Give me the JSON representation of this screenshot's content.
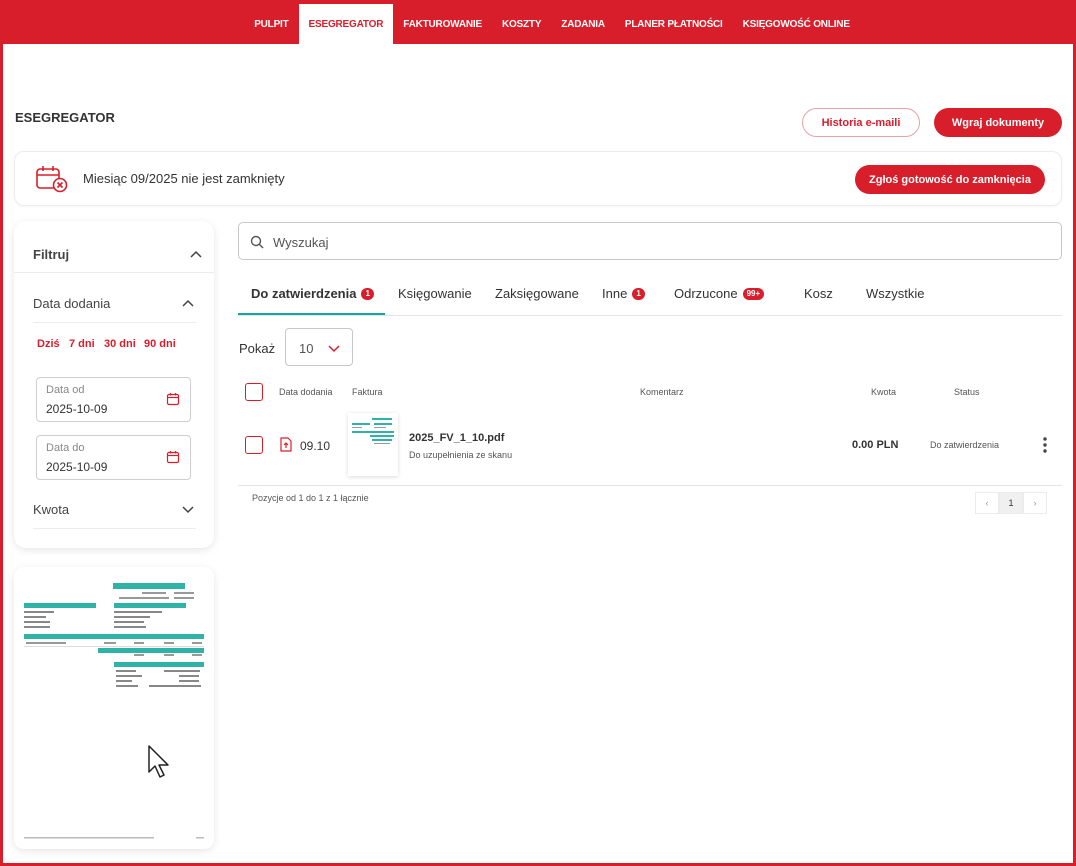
{
  "topnav": {
    "items": [
      {
        "label": "PULPIT",
        "active": false
      },
      {
        "label": "ESEGREGATOR",
        "active": true
      },
      {
        "label": "FAKTUROWANIE",
        "active": false
      },
      {
        "label": "KOSZTY",
        "active": false
      },
      {
        "label": "ZADANIA",
        "active": false
      },
      {
        "label": "PLANER PŁATNOŚCI",
        "active": false
      },
      {
        "label": "KSIĘGOWOŚĆ ONLINE",
        "active": false
      }
    ]
  },
  "header": {
    "title": "ESEGREGATOR",
    "history_button": "Historia e-maili",
    "upload_button": "Wgraj dokumenty"
  },
  "banner": {
    "icon": "calendar-x-icon",
    "text": "Miesiąc 09/2025 nie jest zamknięty",
    "button": "Zgłoś gotowość do zamknięcia"
  },
  "filter": {
    "title": "Filtruj",
    "date_section": "Data dodania",
    "quick": [
      "Dziś",
      "7 dni",
      "30 dni",
      "90 dni"
    ],
    "date_from_label": "Data od",
    "date_from_value": "2025-10-09",
    "date_to_label": "Data do",
    "date_to_value": "2025-10-09",
    "amount_section": "Kwota"
  },
  "search": {
    "placeholder": "Wyszukaj"
  },
  "tabs": [
    {
      "label": "Do zatwierdzenia",
      "badge": "1",
      "active": true
    },
    {
      "label": "Księgowanie",
      "badge": "",
      "active": false
    },
    {
      "label": "Zaksięgowane",
      "badge": "",
      "active": false
    },
    {
      "label": "Inne",
      "badge": "1",
      "active": false
    },
    {
      "label": "Odrzucone",
      "badge": "99+",
      "active": false
    },
    {
      "label": "Kosz",
      "badge": "",
      "active": false
    },
    {
      "label": "Wszystkie",
      "badge": "",
      "active": false
    }
  ],
  "show": {
    "label": "Pokaż",
    "value": "10"
  },
  "table": {
    "headers": [
      "Data dodania",
      "Faktura",
      "Komentarz",
      "Kwota",
      "Status"
    ],
    "rows": [
      {
        "date": "09.10",
        "filename": "2025_FV_1_10.pdf",
        "subtitle": "Do uzupełnienia ze skanu",
        "comment": "",
        "amount": "0.00 PLN",
        "status": "Do zatwierdzenia"
      }
    ]
  },
  "pagination": {
    "text": "Pozycje od 1 do 1 z 1 łącznie",
    "prev": "‹",
    "current": "1",
    "next": "›"
  },
  "colors": {
    "brand": "#d81e2a",
    "accent": "#14a5a0"
  }
}
